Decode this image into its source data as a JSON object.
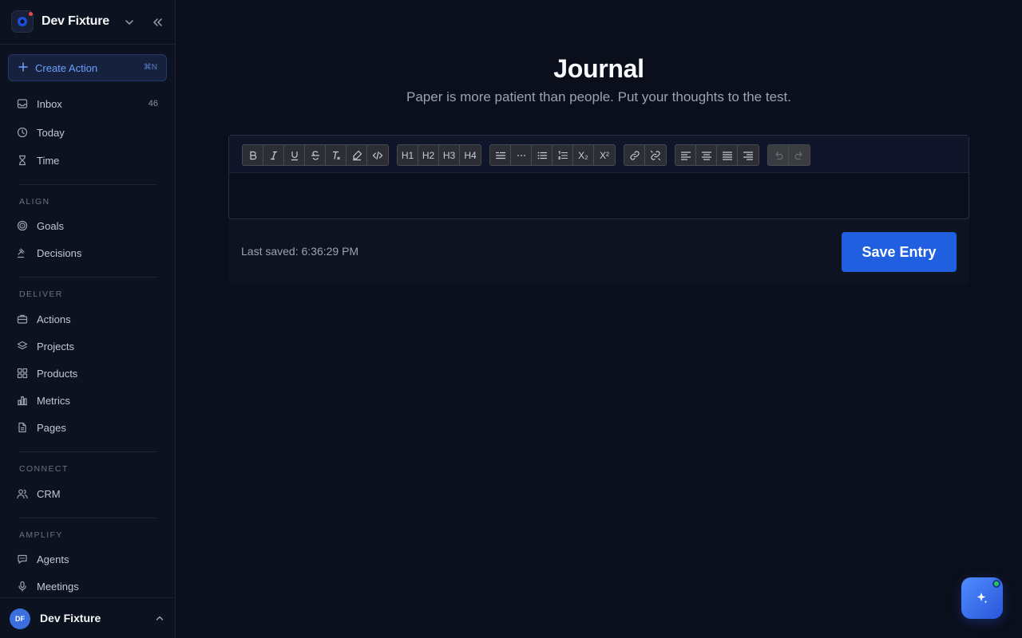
{
  "workspace": {
    "name": "Dev Fixture"
  },
  "create_action": {
    "label": "Create Action",
    "shortcut": "⌘N"
  },
  "nav_top": [
    {
      "label": "Inbox",
      "count": "46",
      "icon": "inbox-icon"
    },
    {
      "label": "Today",
      "icon": "clock-icon"
    },
    {
      "label": "Time",
      "icon": "hourglass-icon"
    }
  ],
  "sections": {
    "align": {
      "label": "ALIGN",
      "items": [
        {
          "label": "Goals",
          "icon": "target-icon"
        },
        {
          "label": "Decisions",
          "icon": "gavel-icon"
        }
      ]
    },
    "deliver": {
      "label": "DELIVER",
      "items": [
        {
          "label": "Actions",
          "icon": "briefcase-icon"
        },
        {
          "label": "Projects",
          "icon": "layers-icon"
        },
        {
          "label": "Products",
          "icon": "grid-icon"
        },
        {
          "label": "Metrics",
          "icon": "bar-chart-icon"
        },
        {
          "label": "Pages",
          "icon": "document-icon"
        }
      ]
    },
    "connect": {
      "label": "CONNECT",
      "items": [
        {
          "label": "CRM",
          "icon": "users-icon"
        }
      ]
    },
    "amplify": {
      "label": "AMPLIFY",
      "items": [
        {
          "label": "Agents",
          "icon": "chat-icon"
        },
        {
          "label": "Meetings",
          "icon": "microphone-icon"
        }
      ]
    }
  },
  "user": {
    "initials": "DF",
    "name": "Dev Fixture"
  },
  "page": {
    "title": "Journal",
    "subtitle": "Paper is more patient than people. Put your thoughts to the test."
  },
  "editor": {
    "content": "",
    "toolbar": {
      "heading_labels": [
        "H1",
        "H2",
        "H3",
        "H4"
      ],
      "subscript": "X₂",
      "superscript": "X²"
    }
  },
  "footer": {
    "last_saved": "Last saved: 6:36:29 PM",
    "save_label": "Save Entry"
  },
  "colors": {
    "accent": "#1f5fe0",
    "background": "#0b0f1c",
    "sidebar": "#0d1221"
  }
}
